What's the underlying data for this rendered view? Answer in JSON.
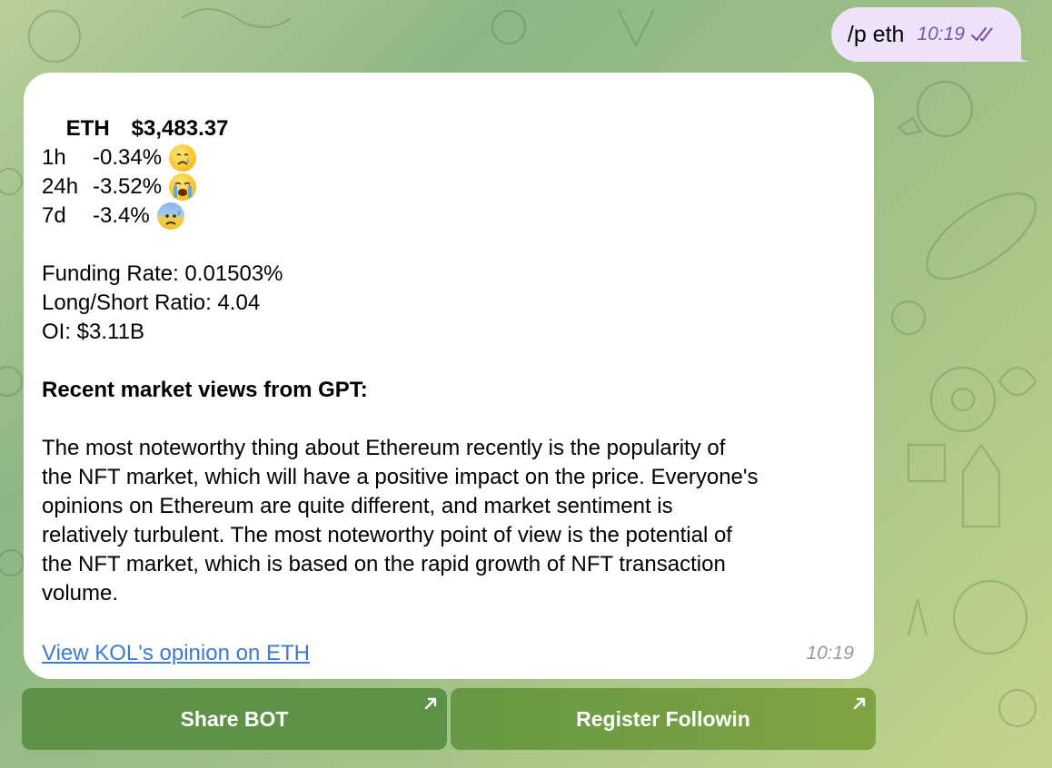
{
  "outgoing": {
    "text": "/p eth",
    "time": "10:19",
    "status_icon": "double-check-icon"
  },
  "reply": {
    "ticker": "ETH",
    "price": "$3,483.37",
    "changes": [
      {
        "period": "1h",
        "value": "-0.34%",
        "emoji": "crying-face-icon"
      },
      {
        "period": "24h",
        "value": "-3.52%",
        "emoji": "loudly-crying-face-icon"
      },
      {
        "period": "7d",
        "value": "-3.4%",
        "emoji": "anxious-face-with-sweat-icon"
      }
    ],
    "funding_rate": "Funding Rate: 0.01503%",
    "long_short_ratio": "Long/Short Ratio: 4.04",
    "open_interest": "OI: $3.11B",
    "views_heading": "Recent market views from GPT:",
    "views_lines": [
      "The most noteworthy thing about Ethereum recently is the popularity of",
      "the NFT market, which will have a positive impact on the price. Everyone's",
      "opinions on Ethereum are quite different, and market sentiment is",
      "relatively turbulent. The most noteworthy point of view is the potential of",
      "the NFT market, which is based on the rapid growth of NFT transaction",
      "volume."
    ],
    "link_text": "View KOL's opinion on ETH",
    "time": "10:19"
  },
  "buttons": [
    {
      "label": "Share BOT",
      "icon": "external-arrow-icon"
    },
    {
      "label": "Register Followin",
      "icon": "external-arrow-icon"
    }
  ],
  "colors": {
    "outgoing_bubble": "#eee3fb",
    "outgoing_time": "#7c55a8",
    "link": "#3d7ad0",
    "button": "#5a8d40"
  }
}
